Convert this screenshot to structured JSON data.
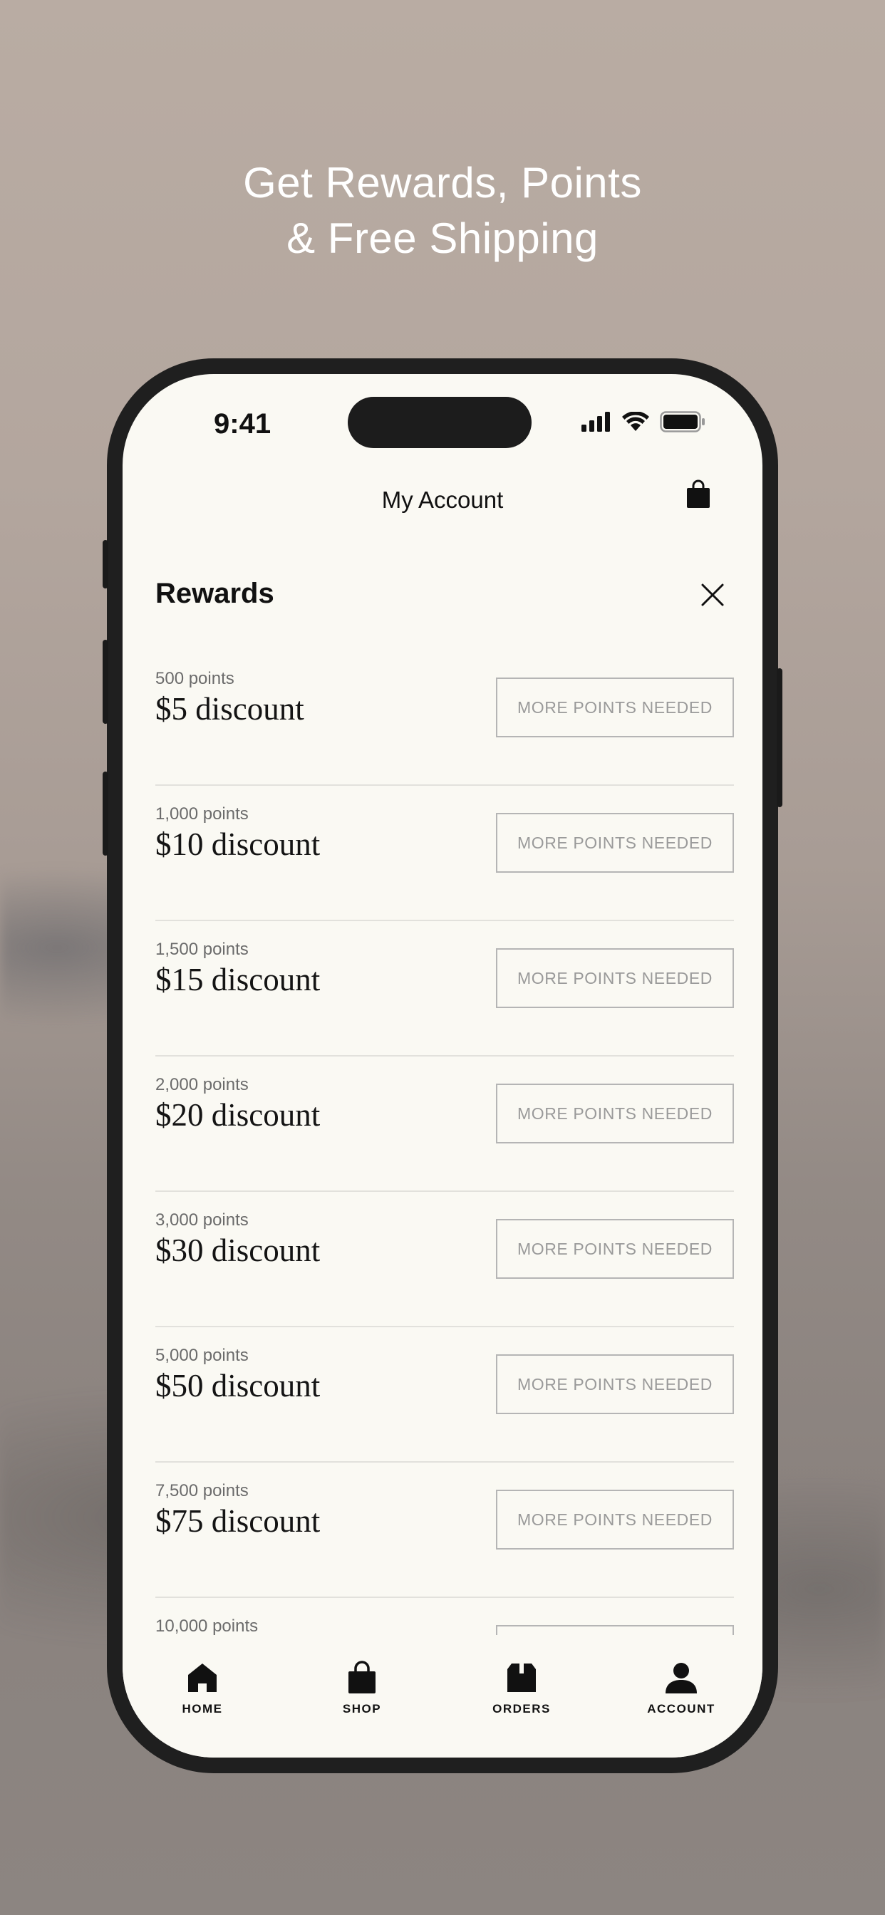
{
  "headline": {
    "line1": "Get Rewards, Points",
    "line2": "& Free Shipping"
  },
  "status_bar": {
    "time": "9:41"
  },
  "nav": {
    "title": "My Account",
    "cart_icon": "shopping-bag-icon"
  },
  "section": {
    "title": "Rewards",
    "close_icon": "close-icon"
  },
  "rewards": [
    {
      "points": "500 points",
      "title": "$5 discount",
      "button": "MORE POINTS NEEDED"
    },
    {
      "points": "1,000 points",
      "title": "$10 discount",
      "button": "MORE POINTS NEEDED"
    },
    {
      "points": "1,500 points",
      "title": "$15 discount",
      "button": "MORE POINTS NEEDED"
    },
    {
      "points": "2,000 points",
      "title": "$20 discount",
      "button": "MORE POINTS NEEDED"
    },
    {
      "points": "3,000 points",
      "title": "$30 discount",
      "button": "MORE POINTS NEEDED"
    },
    {
      "points": "5,000 points",
      "title": "$50 discount",
      "button": "MORE POINTS NEEDED"
    },
    {
      "points": "7,500 points",
      "title": "$75 discount",
      "button": "MORE POINTS NEEDED"
    },
    {
      "points": "10,000 points",
      "title": "",
      "button": ""
    }
  ],
  "tabs": [
    {
      "label": "HOME",
      "icon": "home-icon"
    },
    {
      "label": "SHOP",
      "icon": "shopping-bag-icon"
    },
    {
      "label": "ORDERS",
      "icon": "box-icon"
    },
    {
      "label": "ACCOUNT",
      "icon": "person-icon"
    }
  ],
  "colors": {
    "screen_bg": "#faf9f3",
    "phone_frame": "#1f1f1f",
    "button_border": "#b5b5b5",
    "button_text": "#9a9a9a"
  }
}
